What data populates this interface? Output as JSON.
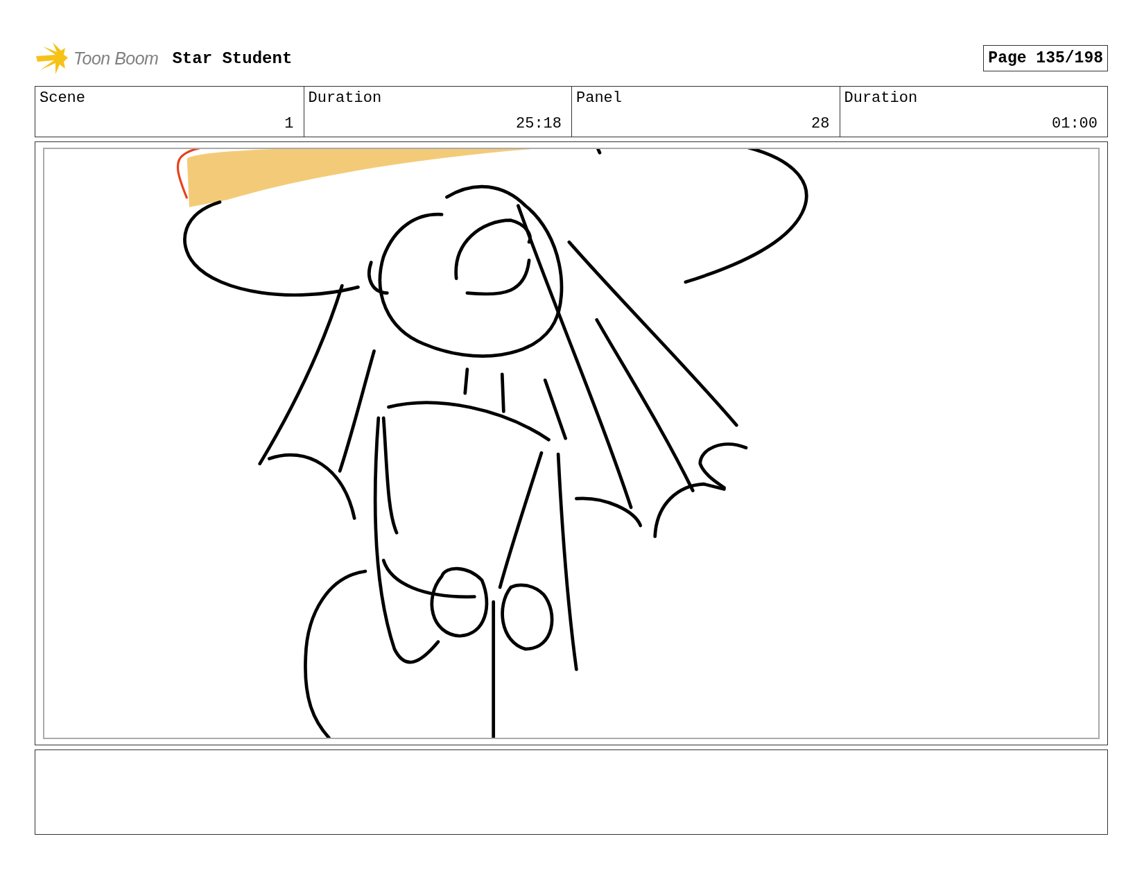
{
  "header": {
    "logo_text": "Toon Boom",
    "project_title": "Star Student",
    "page": "Page 135/198"
  },
  "info_columns": [
    {
      "label": "Scene",
      "value": "1"
    },
    {
      "label": "Duration",
      "value": "25:18"
    },
    {
      "label": "Panel",
      "value": "28"
    },
    {
      "label": "Duration",
      "value": "01:00"
    }
  ]
}
